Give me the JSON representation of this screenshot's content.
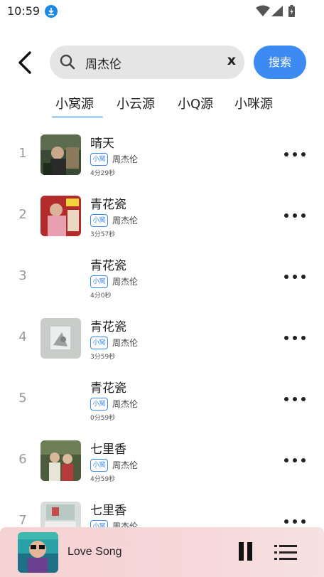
{
  "status_bar": {
    "time": "10:59",
    "icons": [
      "download-notification-icon",
      "wifi-icon",
      "signal-icon",
      "battery-charging-icon"
    ]
  },
  "search": {
    "query": "周杰伦",
    "clear_label": "x",
    "submit_label": "搜索"
  },
  "tabs": [
    {
      "label": "小窝源",
      "active": true
    },
    {
      "label": "小云源",
      "active": false
    },
    {
      "label": "小Q源",
      "active": false
    },
    {
      "label": "小咪源",
      "active": false
    }
  ],
  "songs": [
    {
      "index": "1",
      "title": "晴天",
      "source": "小窝",
      "artist": "周杰伦",
      "duration": "4分29秒",
      "has_cover": true
    },
    {
      "index": "2",
      "title": "青花瓷",
      "source": "小窝",
      "artist": "周杰伦",
      "duration": "3分57秒",
      "has_cover": true
    },
    {
      "index": "3",
      "title": "青花瓷",
      "source": "小窝",
      "artist": "周杰伦",
      "duration": "4分0秒",
      "has_cover": false
    },
    {
      "index": "4",
      "title": "青花瓷",
      "source": "小窝",
      "artist": "周杰伦",
      "duration": "3分59秒",
      "has_cover": true
    },
    {
      "index": "5",
      "title": "青花瓷",
      "source": "小窝",
      "artist": "周杰伦",
      "duration": "0分59秒",
      "has_cover": false
    },
    {
      "index": "6",
      "title": "七里香",
      "source": "小窝",
      "artist": "周杰伦",
      "duration": "4分59秒",
      "has_cover": true
    },
    {
      "index": "7",
      "title": "七里香",
      "source": "小窝",
      "artist": "周杰伦",
      "duration": "",
      "has_cover": true
    }
  ],
  "player": {
    "title": "Love Song",
    "state": "playing"
  },
  "colors": {
    "accent": "#3d8bf2",
    "tab_underline": "#a9d3f0",
    "player_bg": "#f5d2d4"
  }
}
